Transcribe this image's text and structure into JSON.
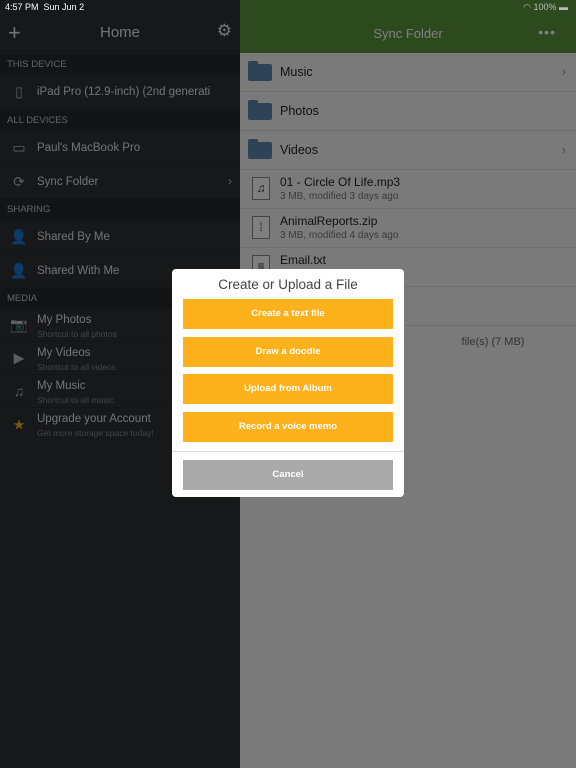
{
  "status": {
    "time": "4:57 PM",
    "date": "Sun Jun 2",
    "battery": "100%"
  },
  "sidebar": {
    "title": "Home",
    "sections": {
      "this_device": "THIS DEVICE",
      "all_devices": "ALL DEVICES",
      "sharing": "SHARING",
      "media": "MEDIA"
    },
    "device": "iPad Pro (12.9-inch) (2nd generati",
    "macbook": "Paul's MacBook Pro",
    "sync": "Sync Folder",
    "shared_by": "Shared By Me",
    "shared_with": "Shared With Me",
    "photos": {
      "label": "My Photos",
      "sub": "Shortcut to all photos"
    },
    "videos": {
      "label": "My Videos",
      "sub": "Shortcut to all videos"
    },
    "music": {
      "label": "My Music",
      "sub": "Shortcut to all music"
    },
    "upgrade": {
      "label": "Upgrade your Account",
      "sub": "Get more storage space today!"
    }
  },
  "main": {
    "title": "Sync Folder",
    "folders": [
      "Music",
      "Photos",
      "Videos"
    ],
    "files": [
      {
        "name": "01 - Circle Of Life.mp3",
        "meta": "3 MB, modified 3 days ago"
      },
      {
        "name": "AnimalReports.zip",
        "meta": "3 MB, modified 4 days ago"
      },
      {
        "name": "Email.txt"
      }
    ],
    "footer": "file(s) (7 MB)"
  },
  "modal": {
    "title": "Create or Upload a File",
    "buttons": [
      "Create a text file",
      "Draw a doodle",
      "Upload from Album",
      "Record a voice memo"
    ],
    "cancel": "Cancel"
  },
  "colors": {
    "accent": "#fdb11b",
    "header_green": "#5a943e",
    "sidebar": "#2f3135"
  }
}
